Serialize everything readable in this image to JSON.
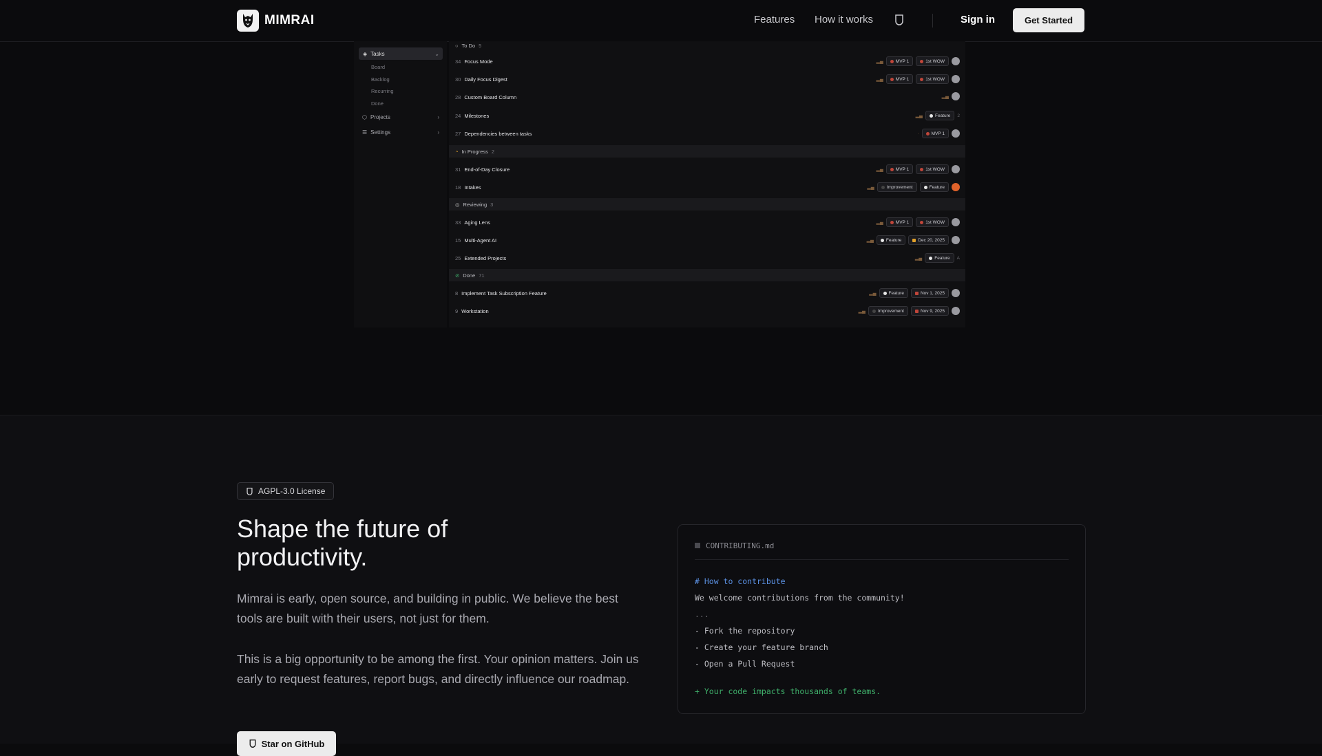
{
  "nav": {
    "brand": "MIMRAI",
    "links": [
      "Features",
      "How it works"
    ],
    "signin": "Sign in",
    "get_started": "Get Started"
  },
  "app": {
    "sidebar": {
      "tasks": "Tasks",
      "sub": [
        "Board",
        "Backlog",
        "Recurring",
        "Done"
      ],
      "projects": "Projects",
      "settings": "Settings"
    },
    "groups": [
      {
        "name": "To Do",
        "count": "5"
      },
      {
        "name": "In Progress",
        "count": "2"
      },
      {
        "name": "Reviewing",
        "count": "3"
      },
      {
        "name": "Done",
        "count": "71"
      }
    ],
    "rows": [
      {
        "num": "34",
        "title": "Focus Mode",
        "tags": [
          "MVP 1",
          "1st WOW"
        ]
      },
      {
        "num": "30",
        "title": "Daily Focus Digest",
        "tags": [
          "MVP 1",
          "1st WOW"
        ]
      },
      {
        "num": "28",
        "title": "Custom Board Column",
        "tags": []
      },
      {
        "num": "24",
        "title": "Milestones",
        "tags": [
          "Feature"
        ],
        "count": "2"
      },
      {
        "num": "27",
        "title": "Dependencies between tasks",
        "tags": [
          "MVP 1"
        ]
      },
      {
        "num": "31",
        "title": "End-of-Day Closure",
        "tags": [
          "MVP 1",
          "1st WOW"
        ]
      },
      {
        "num": "18",
        "title": "Intakes",
        "tags": [
          "Improvement",
          "Feature"
        ]
      },
      {
        "num": "33",
        "title": "Aging Lens",
        "tags": [
          "MVP 1",
          "1st WOW"
        ]
      },
      {
        "num": "15",
        "title": "Multi-Agent AI",
        "tags": [
          "Feature",
          "Dec 20, 2025"
        ]
      },
      {
        "num": "25",
        "title": "Extended Projects",
        "tags": [
          "Feature"
        ],
        "count": "A"
      },
      {
        "num": "8",
        "title": "Implement Task Subscription Feature",
        "tags": [
          "Feature",
          "Nov 1, 2025"
        ]
      },
      {
        "num": "9",
        "title": "Workstation",
        "tags": [
          "Improvement",
          "Nov 9, 2025"
        ]
      }
    ]
  },
  "contrib": {
    "badge": "AGPL-3.0 License",
    "heading": "Shape the future of productivity.",
    "para1": "Mimrai is early, open source, and building in public. We believe the best tools are built with their users, not just for them.",
    "para2": "This is a big opportunity to be among the first. Your opinion matters. Join us early to request features, report bugs, and directly influence our roadmap.",
    "button": "Star on GitHub"
  },
  "code": {
    "filename": "CONTRIBUTING.md",
    "lines": [
      "# How to contribute",
      "We welcome contributions from the community!",
      "...",
      "- Fork the repository",
      "- Create your feature branch",
      "- Open a Pull Request",
      "+ Your code impacts thousands of teams."
    ]
  },
  "colors": {
    "accent_orange": "#e0622a",
    "bg": "#0b0b0d",
    "code_blue": "#5a8fe0",
    "code_green": "#3fae6a"
  }
}
